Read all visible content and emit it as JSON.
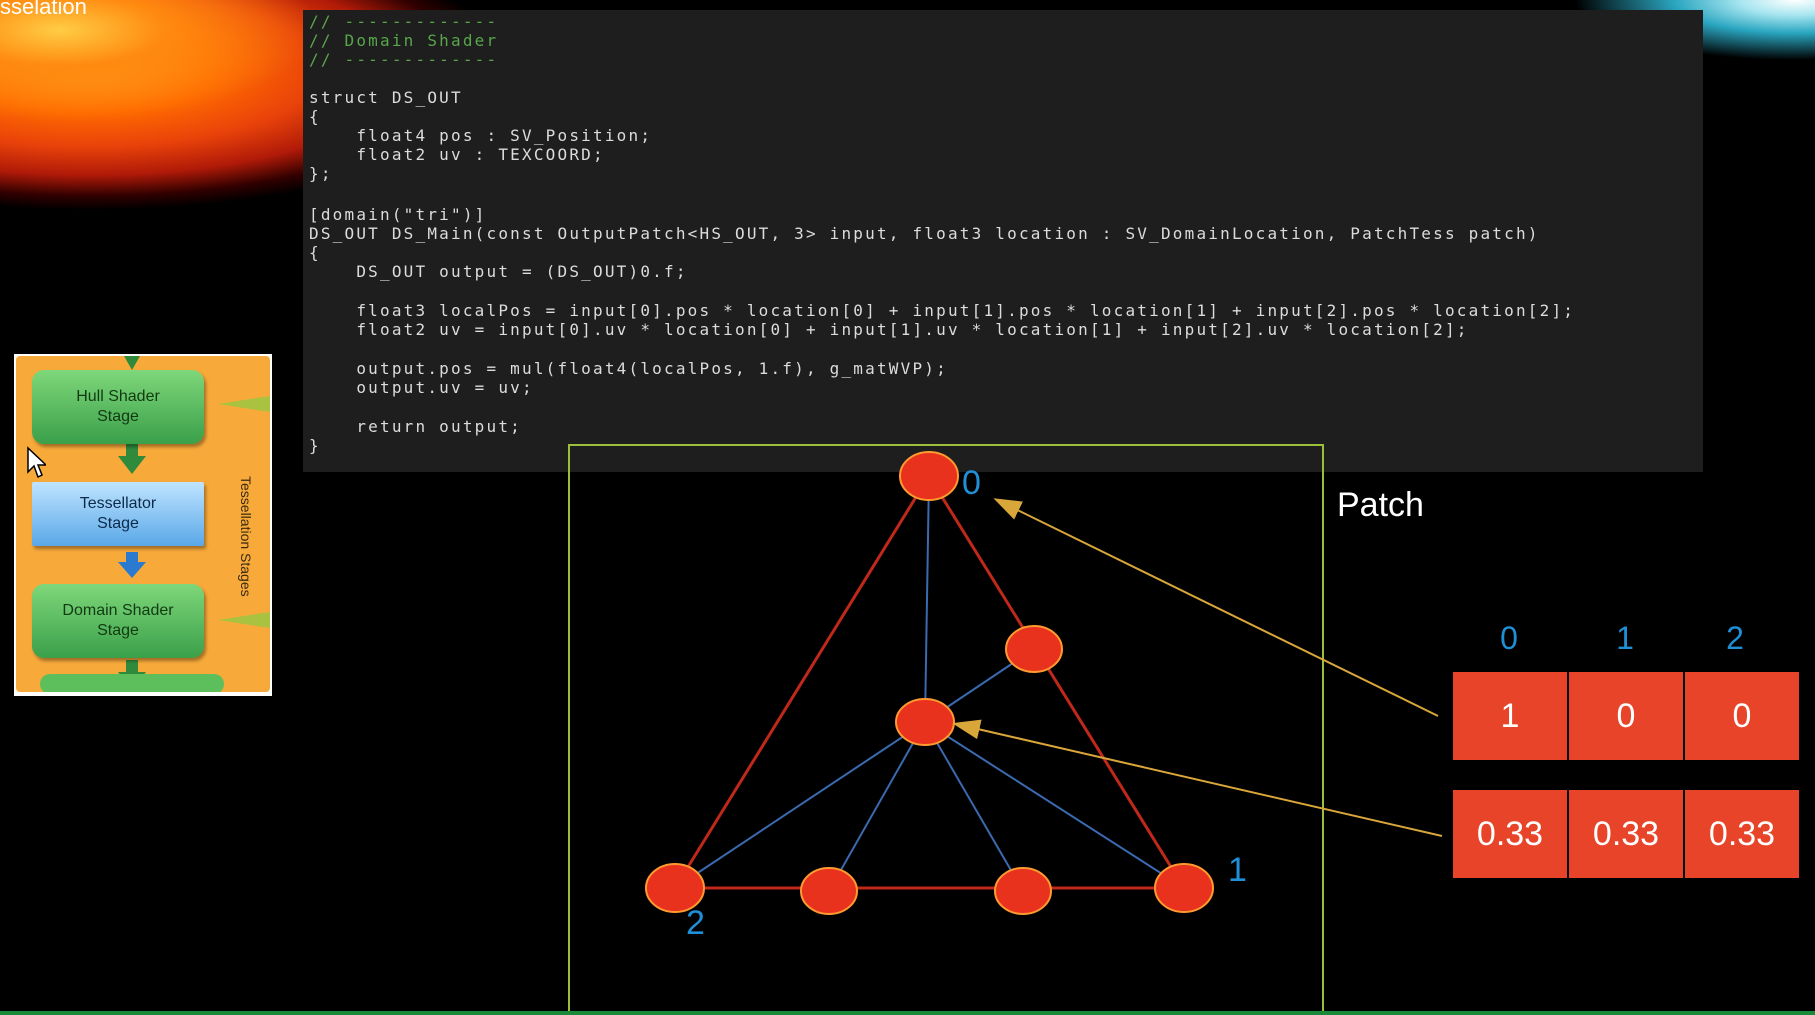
{
  "slide": {
    "title": "sselation"
  },
  "diagram": {
    "stages": [
      "Hull Shader Stage",
      "Tessellator Stage",
      "Domain Shader Stage"
    ],
    "side_label": "Tessellation Stages"
  },
  "code": {
    "lines": [
      "// -------------",
      "// Domain Shader",
      "// -------------",
      "",
      "struct DS_OUT",
      "{",
      "    float4 pos : SV_Position;",
      "    float2 uv : TEXCOORD;",
      "};",
      "",
      "[domain(\"tri\")]",
      "DS_OUT DS_Main(const OutputPatch<HS_OUT, 3> input, float3 location : SV_DomainLocation, PatchTess patch)",
      "{",
      "    DS_OUT output = (DS_OUT)0.f;",
      "",
      "    float3 localPos = input[0].pos * location[0] + input[1].pos * location[1] + input[2].pos * location[2];",
      "    float2 uv = input[0].uv * location[0] + input[1].uv * location[1] + input[2].uv * location[2];",
      "",
      "    output.pos = mul(float4(localPos, 1.f), g_matWVP);",
      "    output.uv = uv;",
      "",
      "    return output;",
      "}"
    ]
  },
  "patch": {
    "label": "Patch",
    "vertex_labels": [
      "0",
      "1",
      "2"
    ]
  },
  "weights": {
    "headers": [
      "0",
      "1",
      "2"
    ],
    "rows": [
      [
        "1",
        "0",
        "0"
      ],
      [
        "0.33",
        "0.33",
        "0.33"
      ]
    ]
  },
  "colors": {
    "node": "#e8321e",
    "triangle_edge": "#c0281a",
    "inner_edge": "#3a6ab0",
    "arrow": "#d9a63a",
    "label_blue": "#1f8fd6",
    "cell": "#e8442a"
  }
}
